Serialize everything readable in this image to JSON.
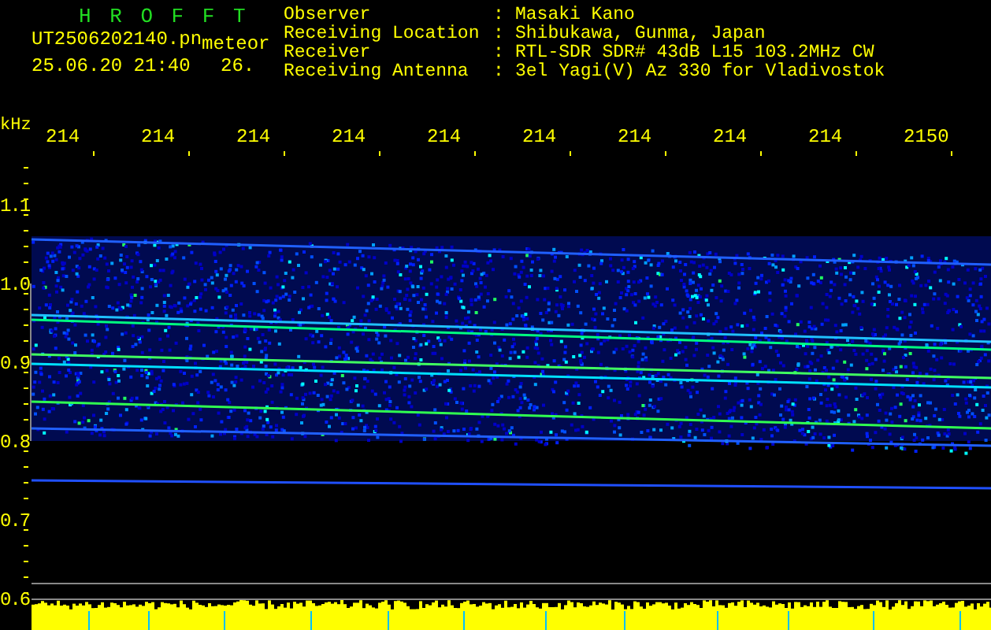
{
  "title": "H R O F F T",
  "file_name": "UT2506202140.pn",
  "mode": "meteor",
  "timestamp": "25.06.20 21:40",
  "count": "26.",
  "info": [
    {
      "label": "Observer",
      "separator": ":",
      "value": "Masaki Kano"
    },
    {
      "label": "Receiving Location",
      "separator": ":",
      "value": "Shibukawa, Gunma, Japan"
    },
    {
      "label": "Receiver",
      "separator": ":",
      "value": "RTL-SDR SDR# 43dB L15 103.2MHz CW"
    },
    {
      "label": "Receiving Antenna",
      "separator": ":",
      "value": "3el Yagi(V) Az 330 for Vladivostok"
    }
  ],
  "y_unit": "kHz",
  "x_labels": [
    "214",
    "214",
    "214",
    "214",
    "214",
    "214",
    "214",
    "214",
    "214",
    "2150"
  ],
  "y_labels": [
    "1.1",
    "1.0",
    "0.9",
    "0.8",
    "0.7",
    "0.6"
  ]
}
